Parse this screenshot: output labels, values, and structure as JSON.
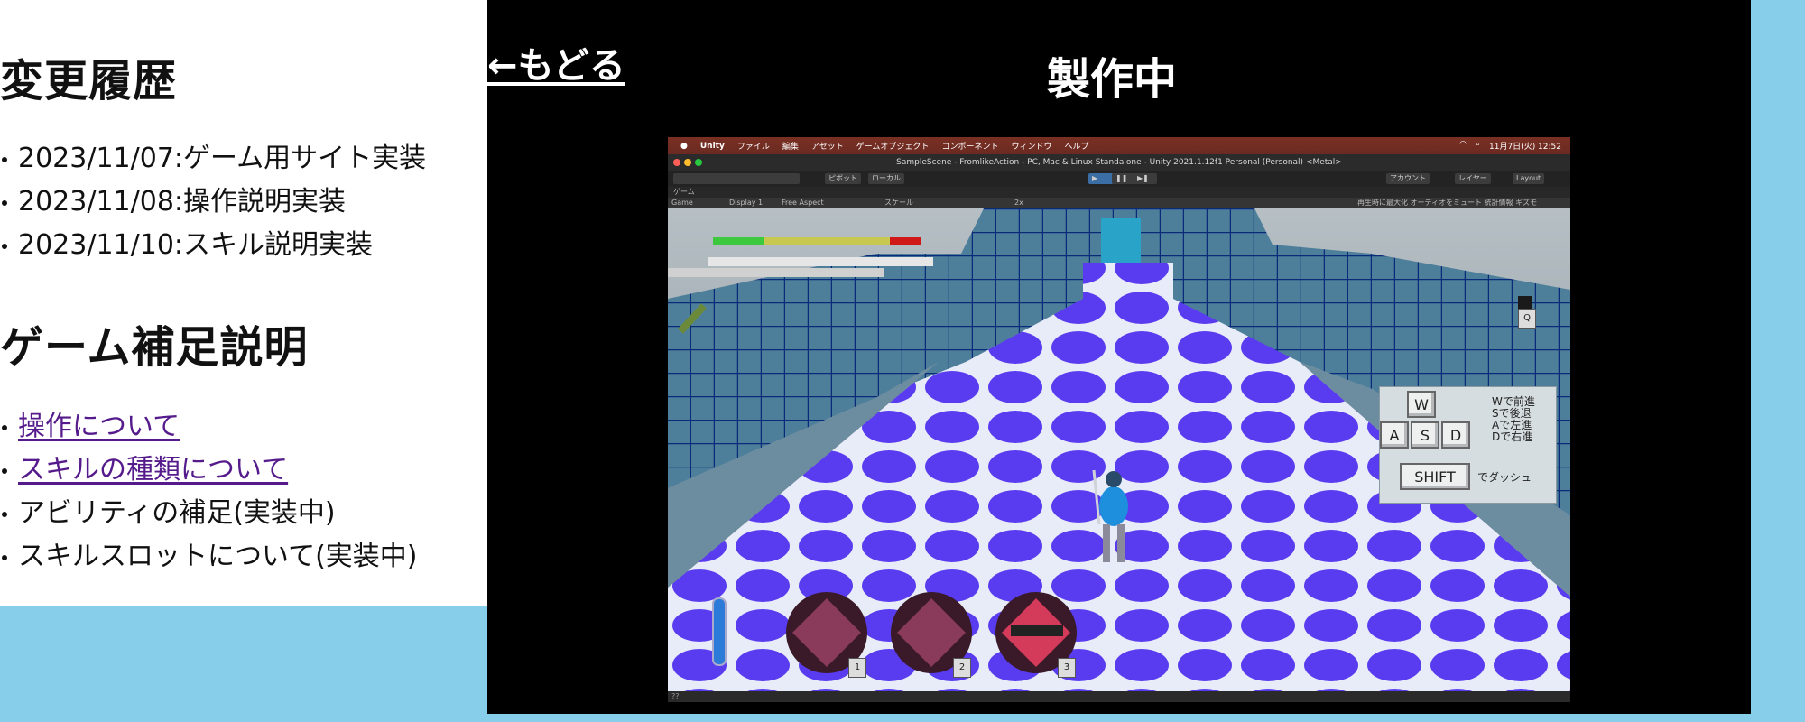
{
  "sidebar": {
    "history_heading": "変更履歴",
    "history_items": [
      "2023/11/07:ゲーム用サイト実装",
      "2023/11/08:操作説明実装",
      "2023/11/10:スキル説明実装"
    ],
    "supplement_heading": "ゲーム補足説明",
    "supplement_links": [
      "操作について",
      "スキルの種類について"
    ],
    "supplement_items": [
      "アビリティの補足(実装中)",
      "スキルスロットについて(実装中)"
    ]
  },
  "main": {
    "back_link": "←もどる",
    "title": "製作中"
  },
  "screenshot": {
    "menubar": [
      "Unity",
      "ファイル",
      "編集",
      "アセット",
      "ゲームオブジェクト",
      "コンポーネント",
      "ウィンドウ",
      "ヘルプ"
    ],
    "clock": "11月7日(火) 12:52",
    "window_title": "SampleScene - FromlikeAction - PC, Mac & Linux Standalone - Unity 2021.1.12f1 Personal (Personal) <Metal>",
    "toolbar_left": [
      "ピボット",
      "ローカル"
    ],
    "toolbar_right": [
      "アカウント",
      "レイヤー",
      "Layout"
    ],
    "game_tab": "ゲーム",
    "game_bar": {
      "game": "Game",
      "display": "Display 1",
      "aspect": "Free Aspect",
      "scale_label": "スケール",
      "scale_value": "2x",
      "right_options": "再生時に最大化  オーディオをミュート  統計情報  ギズモ"
    },
    "help": {
      "keys": [
        "W",
        "A",
        "S",
        "D"
      ],
      "lines": [
        "Wで前進",
        "Sで後退",
        "Aで左進",
        "Dで右進"
      ],
      "shift_key": "SHIFT",
      "shift_text": "でダッシュ"
    },
    "skill_slots": [
      "1",
      "2",
      "3"
    ],
    "q_key": "Q",
    "status": "??",
    "colors": {
      "hp_green": "#3ec83e",
      "hp_yellow": "#c8c850",
      "hp_red": "#d01818",
      "floor": "#5a3cf0",
      "wall": "#3e6c86"
    }
  }
}
